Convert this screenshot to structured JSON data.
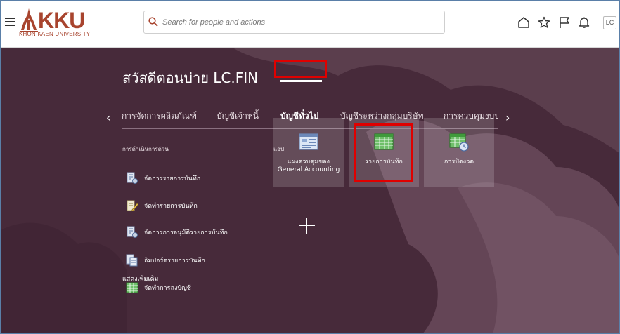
{
  "header": {
    "logo_text": "KKU",
    "logo_sub": "KHON KAEN UNIVERSITY",
    "search_placeholder": "Search for people and actions",
    "user_initials": "LC"
  },
  "greeting": "สวัสดีตอนบ่าย LC.FIN",
  "tabs": [
    {
      "label": "การจัดการผลิตภัณฑ์"
    },
    {
      "label": "บัญชีเจ้าหนี้"
    },
    {
      "label": "บัญชีทั่วไป",
      "active": true
    },
    {
      "label": "บัญชีระหว่างกลุ่มบริษัท"
    },
    {
      "label": "การควบคุมงบป:"
    }
  ],
  "quick_actions": {
    "title": "การดำเนินการด่วน",
    "items": [
      {
        "label": "จัดการรายการบันทึก"
      },
      {
        "label": "จัดทำรายการบันทึก"
      },
      {
        "label": "จัดการการอนุมัติรายการบันทึก"
      },
      {
        "label": "อิมปอร์ตรายการบันทึก"
      },
      {
        "label": "จัดทำการลงบัญชี"
      }
    ]
  },
  "apps": {
    "title": "แอป",
    "tiles": [
      {
        "label": "แผงควบคุมของ General Accounting"
      },
      {
        "label": "รายการบันทึก"
      },
      {
        "label": "การปิดงวด"
      }
    ]
  },
  "show_more": "แสดงเพิ่มเติม",
  "colors": {
    "background": "#4a2c3c",
    "brand": "#a8442e",
    "highlight": "#e00000"
  }
}
